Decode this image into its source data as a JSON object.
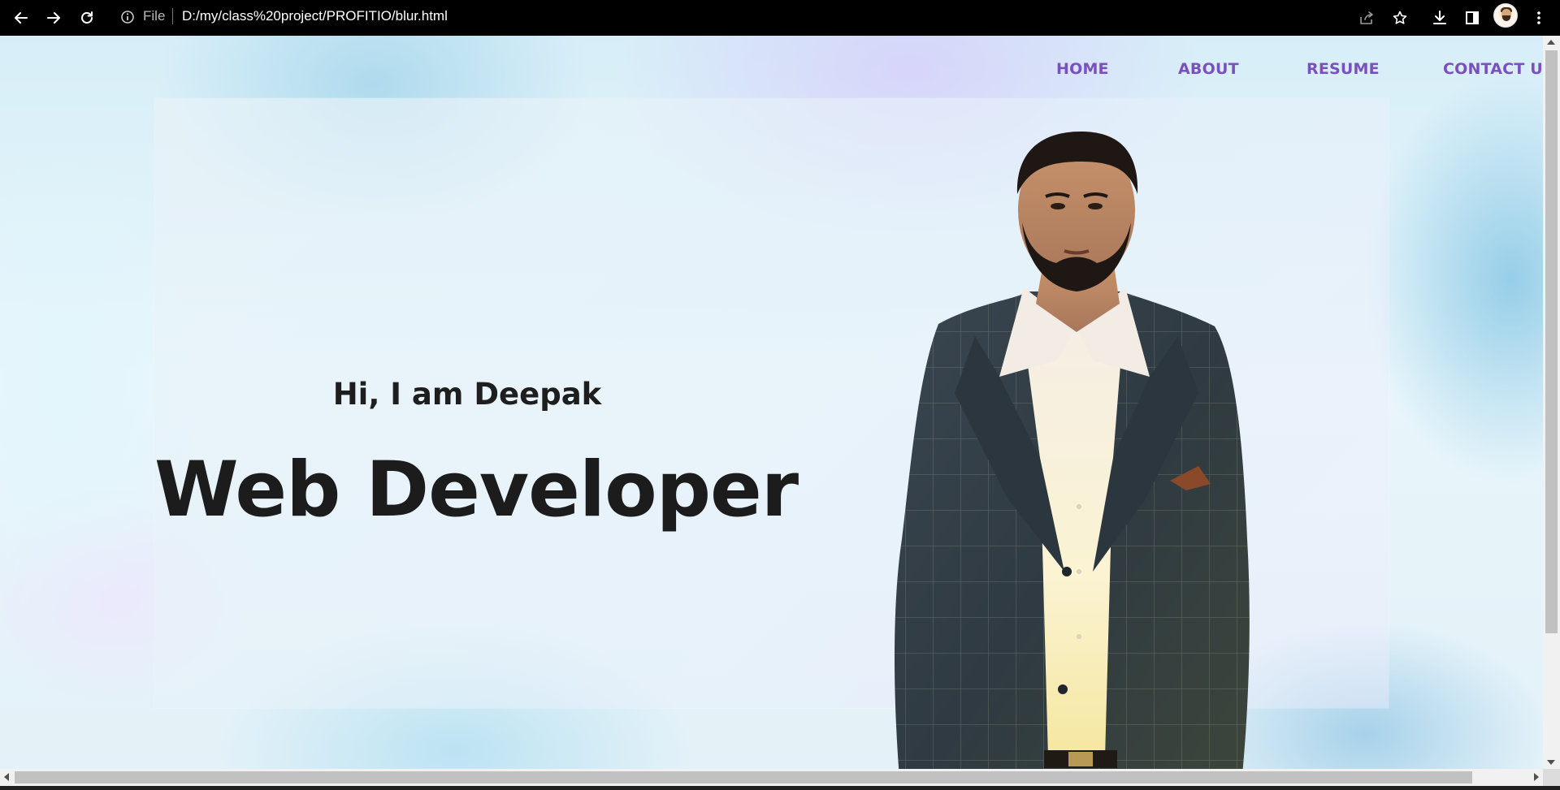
{
  "browser": {
    "address": {
      "scheme_label": "File",
      "url": "D:/my/class%20project/PROFITIO/blur.html"
    },
    "icons": {
      "back": "back-arrow-icon",
      "forward": "forward-arrow-icon",
      "reload": "reload-icon",
      "info": "info-icon",
      "share": "share-icon",
      "bookmark": "star-icon",
      "download": "download-icon",
      "side_panel": "side-panel-icon",
      "menu": "kebab-menu-icon"
    }
  },
  "nav": {
    "items": [
      {
        "label": "HOME"
      },
      {
        "label": "ABOUT"
      },
      {
        "label": "RESUME"
      },
      {
        "label": "CONTACT US"
      }
    ]
  },
  "hero": {
    "greeting": "Hi, I am Deepak",
    "title": "Web Developer"
  },
  "colors": {
    "nav_link": "#7a4fbf",
    "heading": "#1c1c1c",
    "chrome_bg": "#000000"
  }
}
